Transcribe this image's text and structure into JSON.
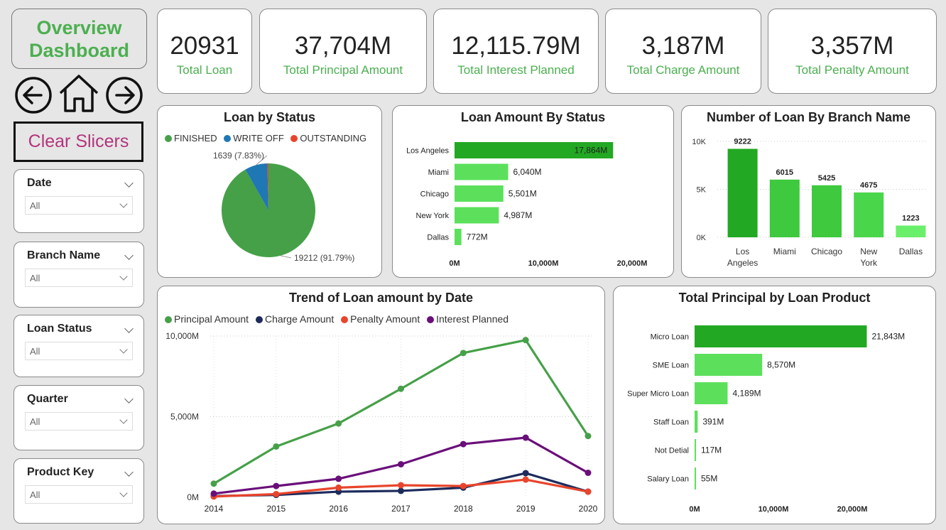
{
  "nav": {
    "title_line1": "Overview",
    "title_line2": "Dashboard",
    "clear_label": "Clear Slicers",
    "back_icon": "circle-arrow-left-icon",
    "home_icon": "home-icon",
    "forward_icon": "circle-arrow-right-icon"
  },
  "slicers": [
    {
      "label": "Date",
      "value": "All"
    },
    {
      "label": "Branch Name",
      "value": "All"
    },
    {
      "label": "Loan Status",
      "value": "All"
    },
    {
      "label": "Quarter",
      "value": "All"
    },
    {
      "label": "Product Key",
      "value": "All"
    }
  ],
  "kpis": [
    {
      "value": "20931",
      "caption": "Total Loan"
    },
    {
      "value": "37,704M",
      "caption": "Total Principal Amount"
    },
    {
      "value": "12,115.79M",
      "caption": "Total Interest Planned"
    },
    {
      "value": "3,187M",
      "caption": "Total Charge Amount"
    },
    {
      "value": "3,357M",
      "caption": "Total Penalty Amount"
    }
  ],
  "colors": {
    "accent_green": "#4caf50",
    "finished": "#46a048",
    "write_off": "#1f77b4",
    "outstanding": "#e8452c",
    "principal": "#46a048",
    "charge": "#1d2b5c",
    "penalty": "#e8452c",
    "interest": "#6a0f7a",
    "clear_text": "#b2357c"
  },
  "chart_data": [
    {
      "type": "pie",
      "title": "Loan by Status",
      "legend": [
        "FINISHED",
        "WRITE OFF",
        "OUTSTANDING"
      ],
      "values": [
        19212,
        1639,
        80
      ],
      "data_labels": [
        "19212 (91.79%)",
        "1639 (7.83%)",
        ""
      ]
    },
    {
      "type": "bar",
      "orientation": "horizontal",
      "title": "Loan Amount By Status",
      "categories": [
        "Los Angeles",
        "Miami",
        "Chicago",
        "New York",
        "Dallas"
      ],
      "values": [
        17864,
        6040,
        5501,
        4987,
        772
      ],
      "data_labels": [
        "17,864M",
        "6,040M",
        "5,501M",
        "4,987M",
        "772M"
      ],
      "xlim": [
        0,
        20000
      ],
      "xticks": [
        "0M",
        "10,000M",
        "20,000M"
      ]
    },
    {
      "type": "bar",
      "title": "Number of Loan By Branch Name",
      "categories": [
        "Los Angeles",
        "Miami",
        "Chicago",
        "New York",
        "Dallas"
      ],
      "category_lines": [
        [
          "Los",
          "Angeles"
        ],
        [
          "Miami"
        ],
        [
          "Chicago"
        ],
        [
          "New",
          "York"
        ],
        [
          "Dallas"
        ]
      ],
      "values": [
        9222,
        6015,
        5425,
        4675,
        1223
      ],
      "data_labels": [
        "9222",
        "6015",
        "5425",
        "4675",
        "1223"
      ],
      "ylim": [
        0,
        10000
      ],
      "yticks": [
        "0K",
        "5K",
        "10K"
      ]
    },
    {
      "type": "line",
      "title": "Trend of Loan amount by Date",
      "x": [
        "2014",
        "2015",
        "2016",
        "2017",
        "2018",
        "2019",
        "2020"
      ],
      "ylim": [
        0,
        10000
      ],
      "yticks": [
        "0M",
        "5,000M",
        "10,000M"
      ],
      "series": [
        {
          "name": "Principal Amount",
          "values": [
            850,
            3150,
            4580,
            6730,
            8950,
            9750,
            3800
          ]
        },
        {
          "name": "Charge Amount",
          "values": [
            80,
            150,
            350,
            400,
            600,
            1500,
            350
          ]
        },
        {
          "name": "Penalty Amount",
          "values": [
            50,
            200,
            600,
            750,
            700,
            1100,
            350
          ]
        },
        {
          "name": "Interest Planned",
          "values": [
            230,
            700,
            1150,
            2050,
            3300,
            3700,
            1520
          ]
        }
      ]
    },
    {
      "type": "bar",
      "orientation": "horizontal",
      "title": "Total Principal by Loan Product",
      "categories": [
        "Micro Loan",
        "SME Loan",
        "Super Micro Loan",
        "Staff Loan",
        "Not Detial",
        "Salary Loan"
      ],
      "values": [
        21843,
        8570,
        4189,
        391,
        117,
        55
      ],
      "data_labels": [
        "21,843M",
        "8,570M",
        "4,189M",
        "391M",
        "117M",
        "55M"
      ],
      "xlim": [
        0,
        20000
      ],
      "xticks": [
        "0M",
        "10,000M",
        "20,000M"
      ]
    }
  ]
}
